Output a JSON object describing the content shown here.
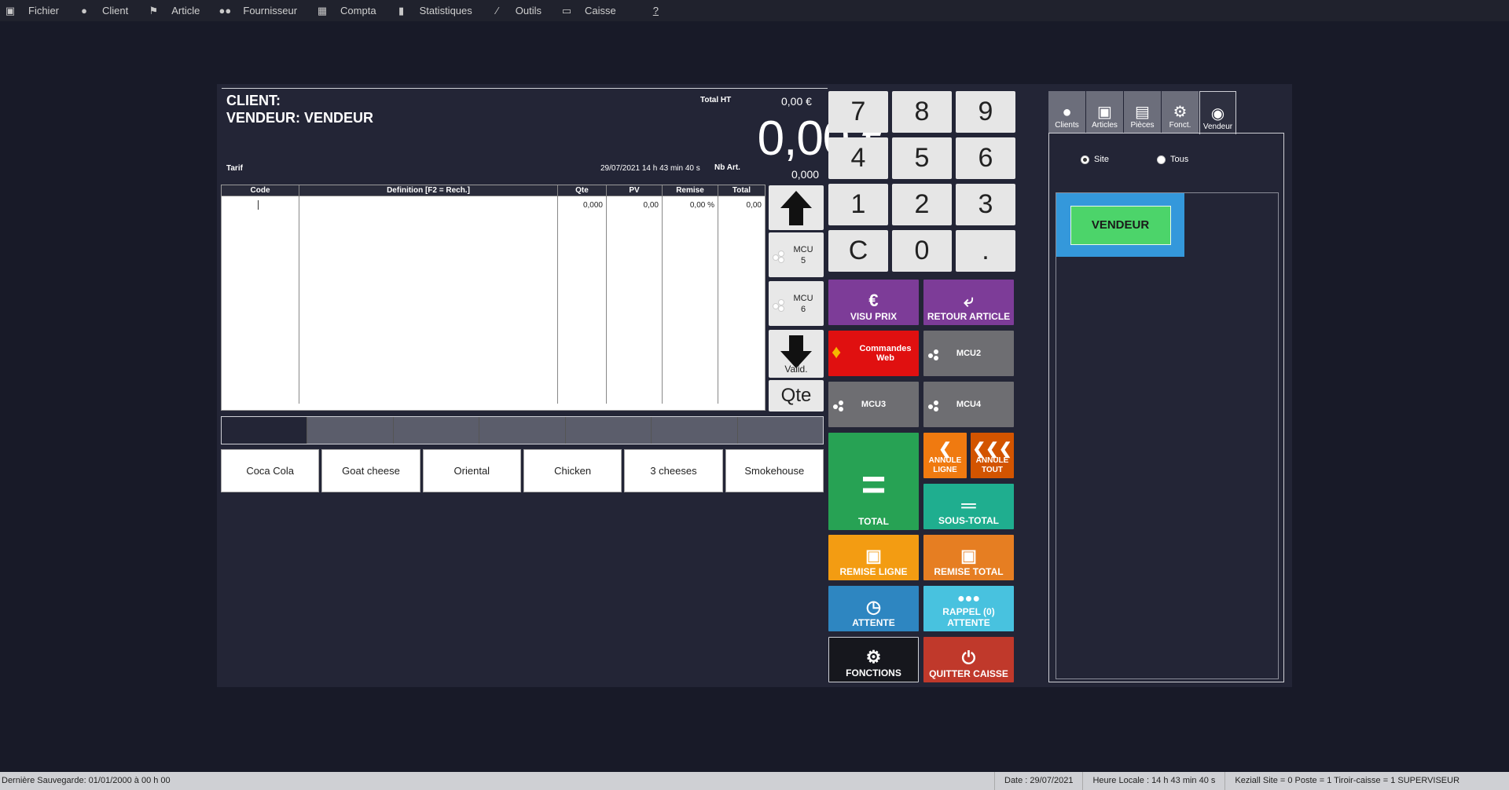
{
  "menu": [
    {
      "icon": "file-icon",
      "label": "Fichier"
    },
    {
      "icon": "user-icon",
      "label": "Client"
    },
    {
      "icon": "article-icon",
      "label": "Article"
    },
    {
      "icon": "suppliers-icon",
      "label": "Fournisseur"
    },
    {
      "icon": "calculator-icon",
      "label": "Compta"
    },
    {
      "icon": "chart-icon",
      "label": "Statistiques"
    },
    {
      "icon": "tools-icon",
      "label": "Outils"
    },
    {
      "icon": "monitor-icon",
      "label": "Caisse"
    },
    {
      "icon": "",
      "label": "?"
    }
  ],
  "header": {
    "client": "CLIENT:",
    "vendeur": "VENDEUR: VENDEUR",
    "tarif": "Tarif",
    "total_ht_label": "Total HT",
    "total_ht_value": "0,00 €",
    "total_big": "0,00 €",
    "datetime": "29/07/2021 14 h 43 min 40 s",
    "nb_art_label": "Nb Art.",
    "nb_art_value": "0,000"
  },
  "table": {
    "columns": [
      "Code",
      "Definition [F2 = Rech.]",
      "Qte",
      "PV",
      "Remise",
      "Total"
    ],
    "first_row": {
      "qte": "0,000",
      "pv": "0,00",
      "remise": "0,00 %",
      "total": "0,00"
    }
  },
  "side": {
    "mcu5": "MCU\n5",
    "mcu5_a": "MCU",
    "mcu5_b": "5",
    "mcu6_a": "MCU",
    "mcu6_b": "6",
    "valid": "Valid.",
    "qte": "Qte"
  },
  "products": [
    "Coca Cola",
    "Goat cheese",
    "Oriental",
    "Chicken",
    "3 cheeses",
    "Smokehouse"
  ],
  "keypad": [
    "7",
    "8",
    "9",
    "4",
    "5",
    "6",
    "1",
    "2",
    "3",
    "C",
    "0",
    "."
  ],
  "actions": {
    "visu_prix": "VISU PRIX",
    "retour_article": "RETOUR ARTICLE",
    "commandes_web": "Commandes Web",
    "mcu2": "MCU2",
    "mcu3": "MCU3",
    "mcu4": "MCU4",
    "total": "TOTAL",
    "annule_ligne": "ANNULE LIGNE",
    "annule_tout": "ANNULE TOUT",
    "sous_total": "SOUS-TOTAL",
    "remise_ligne": "REMISE LIGNE",
    "remise_total": "REMISE TOTAL",
    "attente": "ATTENTE",
    "rappel_attente": "RAPPEL (0) ATTENTE",
    "fonctions": "FONCTIONS",
    "quitter_caisse": "QUITTER CAISSE"
  },
  "right_tabs": [
    "Clients",
    "Articles",
    "Pièces",
    "Fonct.",
    "Vendeur"
  ],
  "right_panel": {
    "radio_site": "Site",
    "radio_tous": "Tous",
    "vendeur_button": "VENDEUR"
  },
  "status": {
    "last_save": "Dernière Sauvegarde: 01/01/2000 à 00 h 00",
    "date": "Date : 29/07/2021",
    "heure": "Heure Locale : 14 h 43 min 40 s",
    "info": "Keziall  Site = 0   Poste = 1   Tiroir-caisse = 1 SUPERVISEUR"
  },
  "colors": {
    "bg": "#181a28",
    "panel": "#232536",
    "purple": "#7d3c98",
    "red": "#e01010",
    "gray_btn": "#6e6e72",
    "green": "#27a254",
    "orange_dark": "#d35400",
    "teal": "#1abc9c",
    "orange": "#f39c12",
    "blue": "#2e86c1",
    "cyan": "#48c2df",
    "black": "#16171d",
    "quit_red": "#c0392b",
    "vendeur_green": "#4cd46a",
    "vendeur_blue": "#3498db"
  }
}
